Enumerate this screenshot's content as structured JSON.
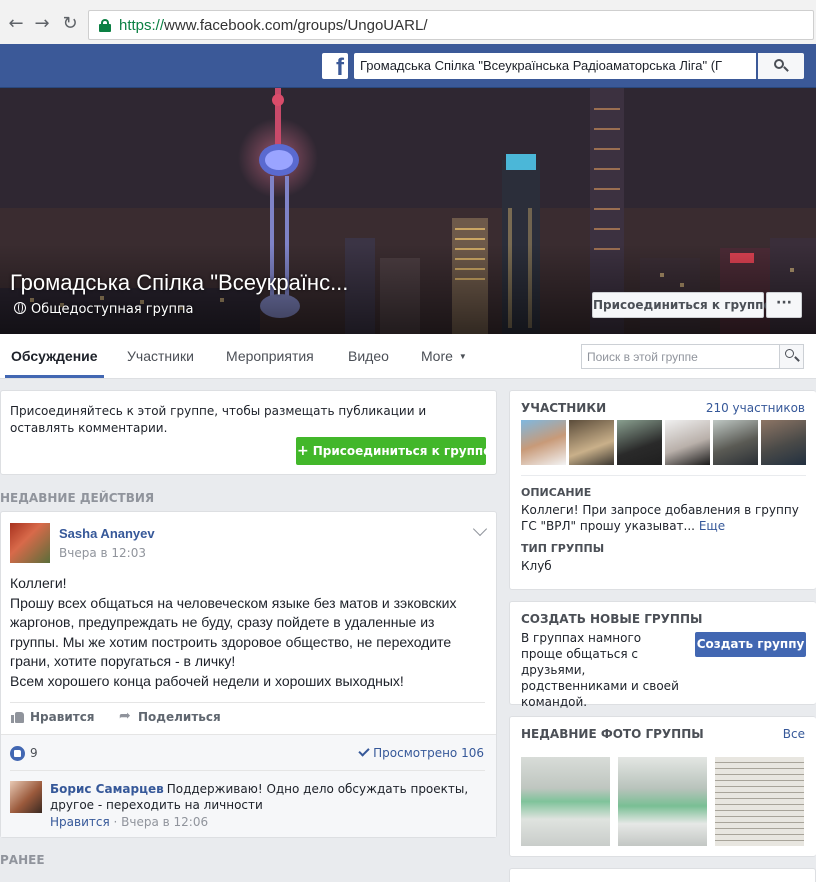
{
  "browser": {
    "url_protocol": "https://",
    "url_rest": "www.facebook.com/groups/UngoUARL/"
  },
  "topbar": {
    "logo": "f",
    "search_value": "Громадська Спілка \"Всеукраїнська Радіоаматорська Ліга\" (Г"
  },
  "cover": {
    "title": "Громадська Спілка \"Всеукраїнс...",
    "privacy": "Общедоступная группа",
    "join_label": "Присоединиться к группе",
    "more_label": "···"
  },
  "tabs": {
    "items": [
      "Обсуждение",
      "Участники",
      "Мероприятия",
      "Видео",
      "More"
    ],
    "search_placeholder": "Поиск в этой группе"
  },
  "join_prompt": {
    "message": "Присоединяйтесь к этой группе, чтобы размещать публикации и оставлять комментарии.",
    "button": "Присоединиться к группе"
  },
  "sections": {
    "recent": "НЕДАВНИЕ ДЕЙСТВИЯ",
    "earlier": "РАНЕЕ"
  },
  "post": {
    "author": "Sasha Ananyev",
    "time": "Вчера в 12:03",
    "lines": [
      "Коллеги!",
      "Прошу всех общаться на человеческом языке без матов и зэковских жаргонов, предупреждать не буду, сразу пойдете в удаленные из группы. Мы же хотим построить здоровое общество, не переходите грани, хотите поругаться - в личку!",
      "Всем хорошего конца рабочей недели и хороших выходных!"
    ],
    "like_action": "Нравится",
    "share_action": "Поделиться",
    "likes": "9",
    "seen": "Просмотрено 106",
    "comment": {
      "author": "Борис Самарцев",
      "text": "Поддерживаю! Одно дело обсуждать проекты, другое - переходить на личности",
      "like": "Нравится",
      "sep": " · ",
      "time": "Вчера в 12:06"
    }
  },
  "members": {
    "heading": "УЧАСТНИКИ",
    "count": "210 участников",
    "description_heading": "ОПИСАНИЕ",
    "description": "Коллеги! При запросе добавления в группу ГС \"ВРЛ\" прошу указыват...",
    "more": "Еще",
    "type_heading": "ТИП ГРУППЫ",
    "type": "Клуб"
  },
  "create_group": {
    "heading": "СОЗДАТЬ НОВЫЕ ГРУППЫ",
    "text": "В группах намного проще общаться с друзьями, родственниками и своей командой.",
    "button": "Создать группу"
  },
  "photos": {
    "heading": "НЕДАВНИЕ ФОТО ГРУППЫ",
    "all": "Все"
  },
  "colors": {
    "fb_blue": "#3b5998",
    "link": "#365899",
    "join_green": "#42b72a",
    "button_blue": "#4267b2"
  }
}
